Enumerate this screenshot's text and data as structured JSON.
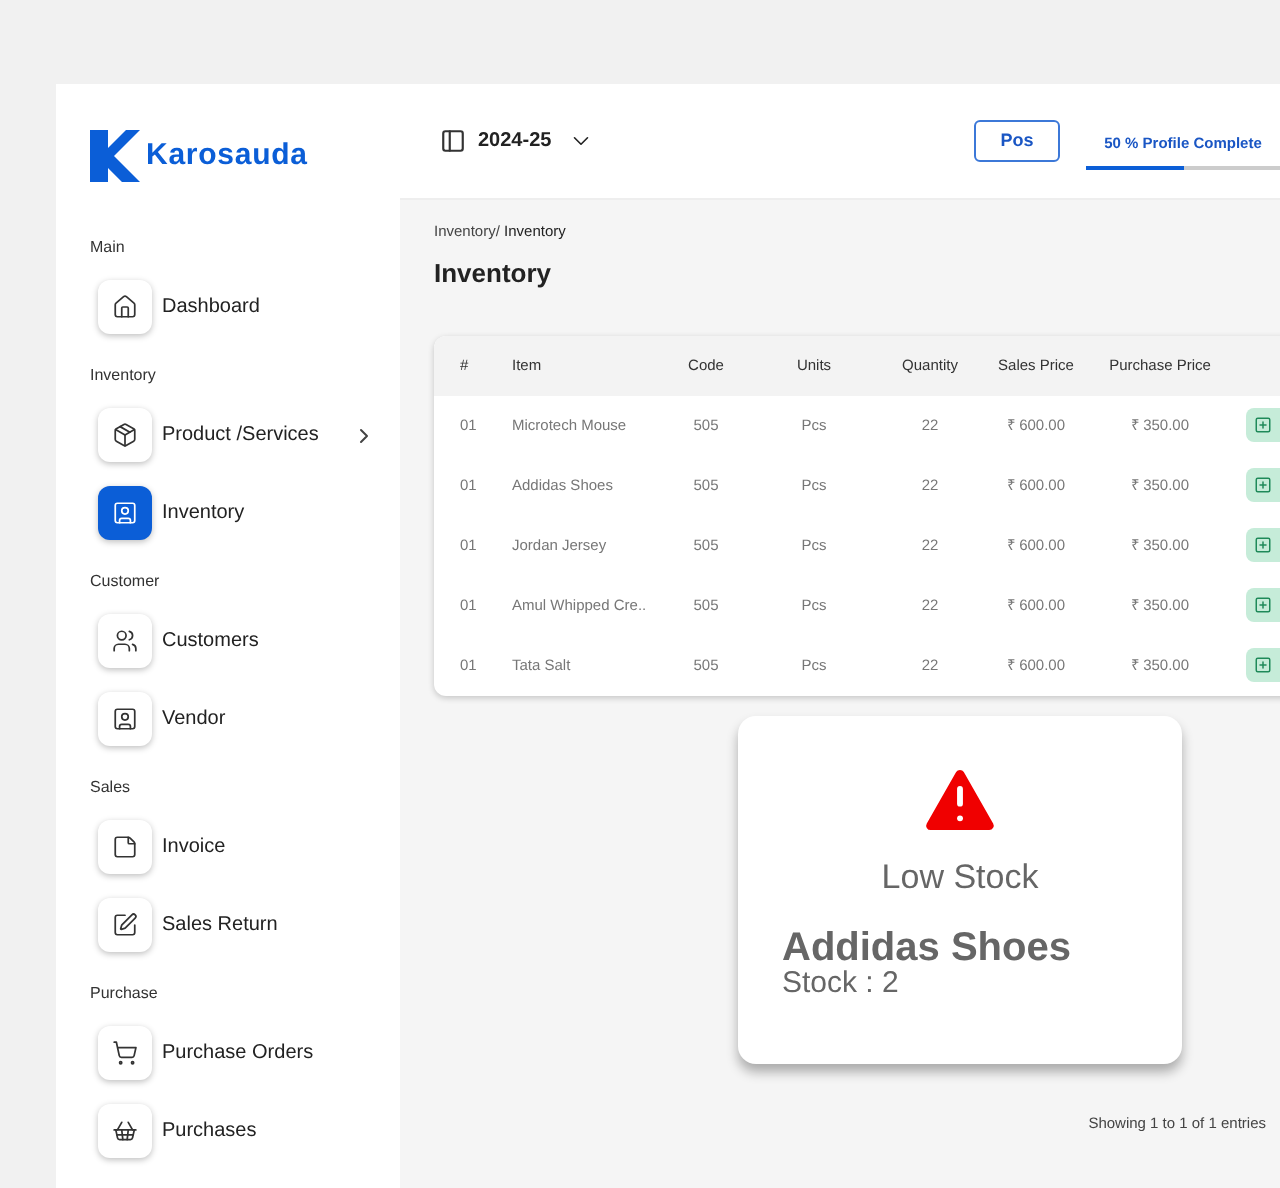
{
  "brand": {
    "name": "Karosauda"
  },
  "header": {
    "year": "2024-25",
    "pos_button": "Pos",
    "profile": {
      "label": "50 % Profile Complete",
      "level": 0.5
    }
  },
  "sidebar": {
    "sections": [
      {
        "title": "Main",
        "items": [
          {
            "label": "Dashboard",
            "kind": "home",
            "selected": false,
            "expandable": false
          }
        ]
      },
      {
        "title": "Inventory",
        "items": [
          {
            "label": "Product /Services",
            "kind": "box",
            "selected": false,
            "expandable": true
          },
          {
            "label": "Inventory",
            "kind": "contact",
            "selected": true,
            "expandable": false
          }
        ]
      },
      {
        "title": "Customer",
        "items": [
          {
            "label": "Customers",
            "kind": "users",
            "selected": false,
            "expandable": false
          },
          {
            "label": "Vendor",
            "kind": "contact",
            "selected": false,
            "expandable": false
          }
        ]
      },
      {
        "title": "Sales",
        "items": [
          {
            "label": "Invoice",
            "kind": "sticky",
            "selected": false,
            "expandable": false
          },
          {
            "label": "Sales Return",
            "kind": "edit",
            "selected": false,
            "expandable": false
          }
        ]
      },
      {
        "title": "Purchase",
        "items": [
          {
            "label": "Purchase Orders",
            "kind": "cart",
            "selected": false,
            "expandable": false
          },
          {
            "label": "Purchases",
            "kind": "basket",
            "selected": false,
            "expandable": false
          }
        ]
      }
    ]
  },
  "breadcrumb": {
    "parent": "Inventory/",
    "current": "Inventory"
  },
  "page_title": "Inventory",
  "table": {
    "columns": [
      "#",
      "Item",
      "Code",
      "Units",
      "Quantity",
      "Sales Price",
      "Purchase Price"
    ],
    "rows": [
      [
        "01",
        "Microtech Mouse",
        "505",
        "Pcs",
        "22",
        "₹ 600.00",
        "₹ 350.00"
      ],
      [
        "01",
        "Addidas Shoes",
        "505",
        "Pcs",
        "22",
        "₹ 600.00",
        "₹ 350.00"
      ],
      [
        "01",
        "Jordan Jersey",
        "505",
        "Pcs",
        "22",
        "₹ 600.00",
        "₹ 350.00"
      ],
      [
        "01",
        "Amul Whipped Cre..",
        "505",
        "Pcs",
        "22",
        "₹ 600.00",
        "₹ 350.00"
      ],
      [
        "01",
        "Tata Salt",
        "505",
        "Pcs",
        "22",
        "₹ 600.00",
        "₹ 350.00"
      ]
    ]
  },
  "alert": {
    "title": "Low Stock",
    "item": "Addidas Shoes",
    "stock": "Stock : 2"
  },
  "footer": {
    "entries": "Showing 1 to 1 of 1 entries"
  }
}
